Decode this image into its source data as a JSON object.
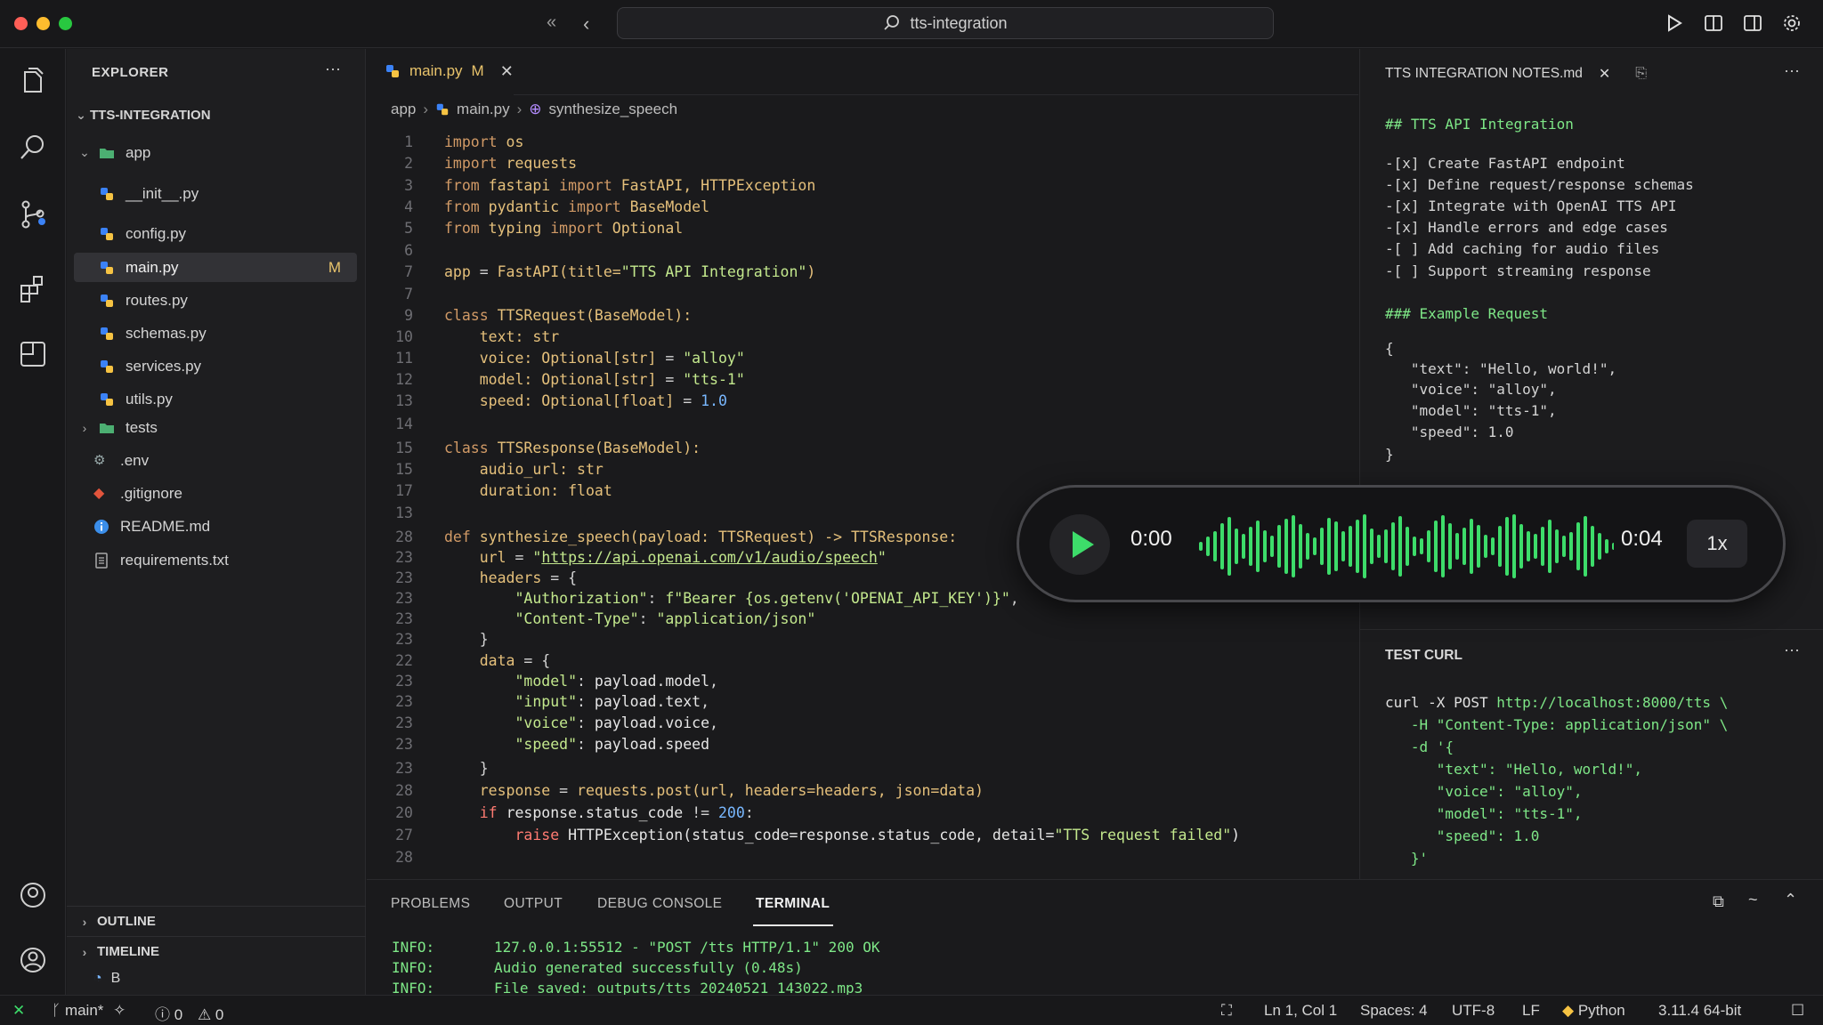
{
  "window": {
    "search_text": "tts-integration"
  },
  "explorer": {
    "title": "EXPLORER",
    "project": "TTS-INTEGRATION",
    "folder_app": "app",
    "files_app": [
      "__init__.py",
      "config.py",
      "main.py",
      "routes.py",
      "schemas.py",
      "services.py",
      "utils.py"
    ],
    "main_badge": "M",
    "folder_tests": "tests",
    "files_root": [
      ".env",
      ".gitignore",
      "README.md",
      "requirements.txt"
    ],
    "outline": "OUTLINE",
    "timeline": "TIMELINE",
    "timeline_item": "B"
  },
  "editor": {
    "tab_label": "main.py",
    "tab_badge": "M",
    "breadcrumb": [
      "app",
      "main.py",
      "synthesize_speech"
    ]
  },
  "code": [
    {
      "n": "1",
      "t": [
        [
          "kw",
          "import "
        ],
        [
          "k",
          "os"
        ]
      ]
    },
    {
      "n": "2",
      "t": [
        [
          "kw",
          "import "
        ],
        [
          "k",
          "requests"
        ]
      ]
    },
    {
      "n": "3",
      "t": [
        [
          "kw",
          "from "
        ],
        [
          "k",
          "fastapi "
        ],
        [
          "kw",
          "import "
        ],
        [
          "k",
          "FastAPI, HTTPException"
        ]
      ]
    },
    {
      "n": "4",
      "t": [
        [
          "kw",
          "from "
        ],
        [
          "k",
          "pydantic "
        ],
        [
          "kw",
          "import "
        ],
        [
          "k",
          "BaseModel"
        ]
      ]
    },
    {
      "n": "5",
      "t": [
        [
          "kw",
          "from "
        ],
        [
          "k",
          "typing "
        ],
        [
          "kw",
          "import "
        ],
        [
          "k",
          "Optional"
        ]
      ]
    },
    {
      "n": "6",
      "t": []
    },
    {
      "n": "7",
      "t": [
        [
          "k",
          "app "
        ],
        [
          "p",
          "= "
        ],
        [
          "k",
          "FastAPI(title="
        ],
        [
          "s",
          "\"TTS API Integration\""
        ],
        [
          "k",
          ")"
        ]
      ]
    },
    {
      "n": "7",
      "t": []
    },
    {
      "n": "9",
      "t": [
        [
          "kw",
          "class "
        ],
        [
          "k",
          "TTSRequest(BaseModel):"
        ]
      ]
    },
    {
      "n": "10",
      "t": [
        [
          "p",
          "    "
        ],
        [
          "k",
          "text: str"
        ]
      ]
    },
    {
      "n": "11",
      "t": [
        [
          "p",
          "    "
        ],
        [
          "k",
          "voice: Optional[str] "
        ],
        [
          "p",
          "= "
        ],
        [
          "s",
          "\"alloy\""
        ]
      ]
    },
    {
      "n": "12",
      "t": [
        [
          "p",
          "    "
        ],
        [
          "k",
          "model: Optional[str] "
        ],
        [
          "p",
          "= "
        ],
        [
          "s",
          "\"tts-1\""
        ]
      ]
    },
    {
      "n": "13",
      "t": [
        [
          "p",
          "    "
        ],
        [
          "k",
          "speed: Optional[float] "
        ],
        [
          "p",
          "= "
        ],
        [
          "n",
          "1.0"
        ]
      ]
    },
    {
      "n": "14",
      "t": []
    },
    {
      "n": "15",
      "t": [
        [
          "kw",
          "class "
        ],
        [
          "k",
          "TTSResponse(BaseModel):"
        ]
      ]
    },
    {
      "n": "15",
      "t": [
        [
          "p",
          "    "
        ],
        [
          "k",
          "audio_url: str"
        ]
      ]
    },
    {
      "n": "17",
      "t": [
        [
          "p",
          "    "
        ],
        [
          "k",
          "duration: float"
        ]
      ]
    },
    {
      "n": "13",
      "t": []
    },
    {
      "n": "28",
      "t": [
        [
          "kw",
          "def "
        ],
        [
          "k",
          "synthesize_speech(payload: TTSRequest) -> TTSResponse:"
        ]
      ]
    },
    {
      "n": "23",
      "t": [
        [
          "p",
          "    "
        ],
        [
          "k",
          "url "
        ],
        [
          "p",
          "= "
        ],
        [
          "s",
          "\""
        ],
        [
          "link",
          "https://api.openai.com/v1/audio/speech"
        ],
        [
          "s",
          "\""
        ]
      ]
    },
    {
      "n": "23",
      "t": [
        [
          "p",
          "    "
        ],
        [
          "k",
          "headers "
        ],
        [
          "p",
          "= {"
        ]
      ]
    },
    {
      "n": "23",
      "t": [
        [
          "p",
          "        "
        ],
        [
          "s",
          "\"Authorization\""
        ],
        [
          "p",
          ": "
        ],
        [
          "s",
          "f\"Bearer {os.getenv('OPENAI_API_KEY')}\""
        ],
        [
          "p",
          ","
        ]
      ]
    },
    {
      "n": "23",
      "t": [
        [
          "p",
          "        "
        ],
        [
          "s",
          "\"Content-Type\""
        ],
        [
          "p",
          ": "
        ],
        [
          "s",
          "\"application/json\""
        ]
      ]
    },
    {
      "n": "23",
      "t": [
        [
          "p",
          "    }"
        ]
      ]
    },
    {
      "n": "22",
      "t": [
        [
          "p",
          "    "
        ],
        [
          "k",
          "data "
        ],
        [
          "p",
          "= {"
        ]
      ]
    },
    {
      "n": "23",
      "t": [
        [
          "p",
          "        "
        ],
        [
          "s",
          "\"model\""
        ],
        [
          "p",
          ": "
        ],
        [
          "w",
          "payload.model"
        ],
        [
          "p",
          ","
        ]
      ]
    },
    {
      "n": "23",
      "t": [
        [
          "p",
          "        "
        ],
        [
          "s",
          "\"input\""
        ],
        [
          "p",
          ": "
        ],
        [
          "w",
          "payload.text"
        ],
        [
          "p",
          ","
        ]
      ]
    },
    {
      "n": "23",
      "t": [
        [
          "p",
          "        "
        ],
        [
          "s",
          "\"voice\""
        ],
        [
          "p",
          ": "
        ],
        [
          "w",
          "payload.voice"
        ],
        [
          "p",
          ","
        ]
      ]
    },
    {
      "n": "23",
      "t": [
        [
          "p",
          "        "
        ],
        [
          "s",
          "\"speed\""
        ],
        [
          "p",
          ": "
        ],
        [
          "w",
          "payload.speed"
        ]
      ]
    },
    {
      "n": "23",
      "t": [
        [
          "p",
          "    }"
        ]
      ]
    },
    {
      "n": "28",
      "t": [
        [
          "p",
          "    "
        ],
        [
          "k",
          "response "
        ],
        [
          "p",
          "= "
        ],
        [
          "k",
          "requests.post(url, headers=headers, json=data)"
        ]
      ]
    },
    {
      "n": "20",
      "t": [
        [
          "p",
          "    "
        ],
        [
          "r",
          "if "
        ],
        [
          "w",
          "response.status_code "
        ],
        [
          "p",
          "!= "
        ],
        [
          "n",
          "200"
        ],
        [
          "p",
          ":"
        ]
      ]
    },
    {
      "n": "27",
      "t": [
        [
          "p",
          "        "
        ],
        [
          "r",
          "raise "
        ],
        [
          "w",
          "HTTPException(status_code=response.status_code, detail="
        ],
        [
          "s",
          "\"TTS request failed\""
        ],
        [
          "w",
          ")"
        ]
      ]
    },
    {
      "n": "28",
      "t": []
    }
  ],
  "notes": {
    "tab_label": "TTS INTEGRATION NOTES.md",
    "lines": [
      {
        "cls": "md-h",
        "text": "## TTS API Integration"
      },
      {
        "cls": "",
        "text": ""
      },
      {
        "cls": "",
        "text": "-[x] Create FastAPI endpoint"
      },
      {
        "cls": "",
        "text": "-[x] Define request/response schemas"
      },
      {
        "cls": "",
        "text": "-[x] Integrate with OpenAI TTS API"
      },
      {
        "cls": "",
        "text": "-[x] Handle errors and edge cases"
      },
      {
        "cls": "",
        "text": "-[ ] Add caching for audio files"
      },
      {
        "cls": "",
        "text": "-[ ] Support streaming response"
      },
      {
        "cls": "",
        "text": ""
      },
      {
        "cls": "md-h",
        "text": "### Example Request"
      },
      {
        "cls": "",
        "text": ""
      },
      {
        "cls": "",
        "text": "{"
      },
      {
        "cls": "",
        "text": "   \"text\": \"Hello, world!\","
      },
      {
        "cls": "",
        "text": "   \"voice\": \"alloy\","
      },
      {
        "cls": "",
        "text": "   \"model\": \"tts-1\","
      },
      {
        "cls": "",
        "text": "   \"speed\": 1.0"
      },
      {
        "cls": "",
        "text": "}"
      }
    ]
  },
  "test_curl": {
    "title": "TEST CURL",
    "lines": [
      "curl -X POST http://localhost:8000/tts \\",
      "   -H \"Content-Type: application/json\" \\",
      "   -d '{",
      "      \"text\": \"Hello, world!\",",
      "      \"voice\": \"alloy\",",
      "      \"model\": \"tts-1\",",
      "      \"speed\": 1.0",
      "   }'"
    ]
  },
  "audio": {
    "current_time": "0:00",
    "duration": "0:04",
    "speed": "1x",
    "accent": "#3ddc6a"
  },
  "panel": {
    "tabs": [
      "PROBLEMS",
      "OUTPUT",
      "DEBUG CONSOLE",
      "TERMINAL"
    ],
    "active_tab": "TERMINAL",
    "terminal": [
      {
        "level": "INFO:",
        "msg": "127.0.0.1:55512 - \"POST /tts HTTP/1.1\" 200 OK"
      },
      {
        "level": "INFO:",
        "msg": "Audio generated successfully (0.48s)"
      },
      {
        "level": "INFO:",
        "msg": "File saved: outputs/tts_20240521_143022.mp3"
      }
    ]
  },
  "status": {
    "branch": "main*",
    "errors": "0",
    "warnings": "0",
    "position": "Ln 1, Col 1",
    "spaces": "Spaces: 4",
    "encoding": "UTF-8",
    "eol": "LF",
    "language": "Python",
    "interpreter": "3.11.4  64-bit"
  }
}
